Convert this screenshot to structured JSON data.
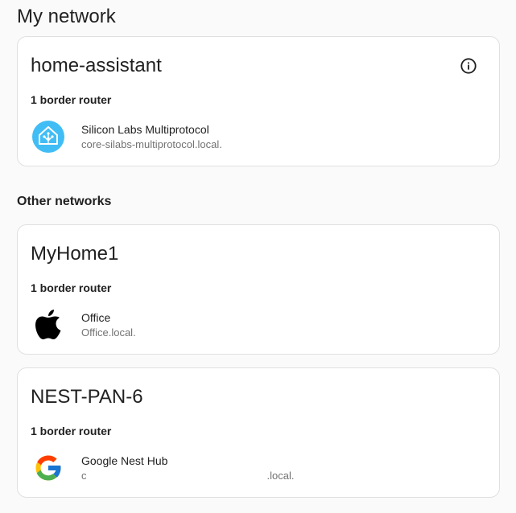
{
  "my_network": {
    "heading": "My network",
    "network": {
      "name": "home-assistant",
      "router_count": "1 border router",
      "router": {
        "icon": "home-assistant-icon",
        "name": "Silicon Labs Multiprotocol",
        "host": "core-silabs-multiprotocol.local."
      }
    }
  },
  "other_networks": {
    "heading": "Other networks",
    "networks": [
      {
        "name": "MyHome1",
        "router_count": "1 border router",
        "router": {
          "icon": "apple-icon",
          "name": "Office",
          "host": "Office.local."
        }
      },
      {
        "name": "NEST-PAN-6",
        "router_count": "1 border router",
        "router": {
          "icon": "google-icon",
          "name": "Google Nest Hub",
          "host_prefix": "c",
          "host_suffix": ".local."
        }
      }
    ]
  },
  "colors": {
    "ha_blue": "#41bdf5",
    "text_primary": "#212121",
    "text_secondary": "#727272",
    "card_border": "#e0e0e0"
  }
}
